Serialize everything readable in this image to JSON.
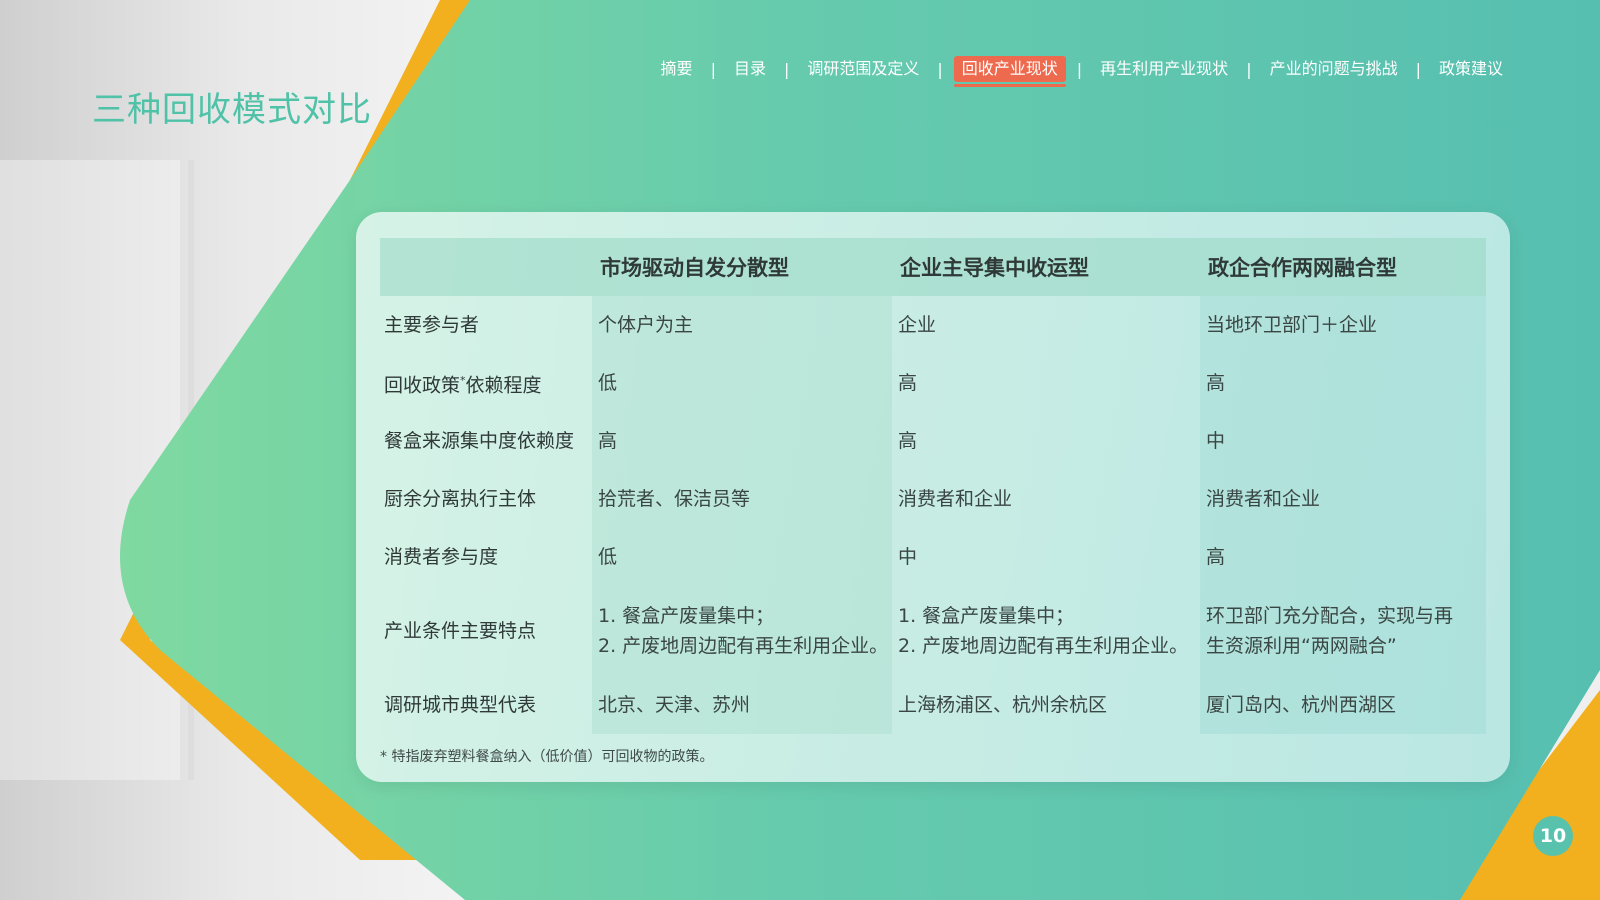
{
  "title": "三种回收模式对比",
  "nav": {
    "items": [
      {
        "label": "摘要",
        "active": false
      },
      {
        "label": "目录",
        "active": false
      },
      {
        "label": "调研范围及定义",
        "active": false
      },
      {
        "label": "回收产业现状",
        "active": true
      },
      {
        "label": "再生利用产业现状",
        "active": false
      },
      {
        "label": "产业的问题与挑战",
        "active": false
      },
      {
        "label": "政策建议",
        "active": false
      }
    ],
    "separator": "|"
  },
  "table": {
    "headers": [
      "",
      "市场驱动自发分散型",
      "企业主导集中收运型",
      "政企合作两网融合型"
    ],
    "rows": [
      {
        "label": "主要参与者",
        "cells": [
          "个体户为主",
          "企业",
          "当地环卫部门＋企业"
        ]
      },
      {
        "label": "回收政策",
        "label_suffix": "依赖程度",
        "star": "*",
        "cells": [
          "低",
          "高",
          "高"
        ]
      },
      {
        "label": "餐盒来源集中度依赖度",
        "cells": [
          "高",
          "高",
          "中"
        ]
      },
      {
        "label": "厨余分离执行主体",
        "cells": [
          "拾荒者、保洁员等",
          "消费者和企业",
          "消费者和企业"
        ]
      },
      {
        "label": "消费者参与度",
        "cells": [
          "低",
          "中",
          "高"
        ]
      },
      {
        "label": "产业条件主要特点",
        "cells": [
          [
            "1. 餐盒产废量集中；",
            "2. 产废地周边配有再生利用企业。"
          ],
          [
            "1. 餐盒产废量集中；",
            "2. 产废地周边配有再生利用企业。"
          ],
          [
            "环卫部门充分配合，实现与再",
            "生资源利用“两网融合”"
          ]
        ]
      },
      {
        "label": "调研城市典型代表",
        "cells": [
          "北京、天津、苏州",
          "上海杨浦区、杭州余杭区",
          "厦门岛内、杭州西湖区"
        ]
      }
    ]
  },
  "footnote": "* 特指废弃塑料餐盒纳入（低价值）可回收物的政策。",
  "page_number": "10",
  "colors": {
    "accent_teal": "#4fc2a7",
    "accent_orange": "#f2b01e",
    "active_tab": "#ee6a4e"
  }
}
